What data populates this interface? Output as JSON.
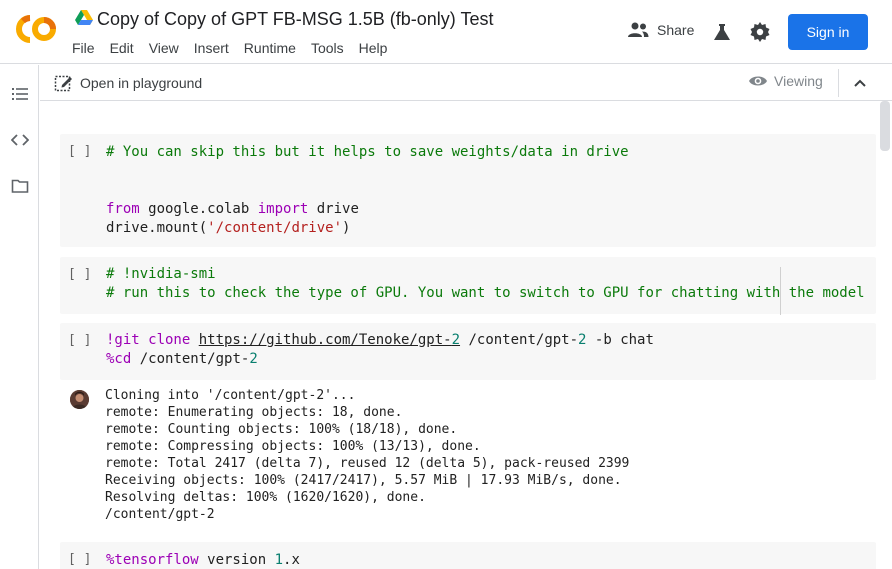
{
  "app": {
    "title": "Copy of Copy of GPT FB-MSG 1.5B (fb-only) Test",
    "logo_text": "CO",
    "menu": [
      "File",
      "Edit",
      "View",
      "Insert",
      "Runtime",
      "Tools",
      "Help"
    ],
    "share_label": "Share",
    "signin_label": "Sign in",
    "accent": "#1a73e8"
  },
  "toolbar": {
    "playground_label": "Open in playground",
    "viewing_label": "Viewing"
  },
  "cells": [
    {
      "run": "[ ]",
      "lines": [
        "# You can skip this but it helps to save weights/data in drive",
        "",
        "",
        "from google.colab import drive",
        "drive.mount('/content/drive')"
      ]
    },
    {
      "run": "[ ]",
      "lines": [
        "# !nvidia-smi",
        "# run this to check the type of GPU. You want to switch to GPU for chatting with the model"
      ]
    },
    {
      "run": "[ ]",
      "lines": [
        "!git clone https://github.com/Tenoke/gpt-2 /content/gpt-2 -b chat",
        "%cd /content/gpt-2"
      ],
      "output": [
        "Cloning into '/content/gpt-2'...",
        "remote: Enumerating objects: 18, done.",
        "remote: Counting objects: 100% (18/18), done.",
        "remote: Compressing objects: 100% (13/13), done.",
        "remote: Total 2417 (delta 7), reused 12 (delta 5), pack-reused 2399",
        "Receiving objects: 100% (2417/2417), 5.57 MiB | 17.93 MiB/s, done.",
        "Resolving deltas: 100% (1620/1620), done.",
        "/content/gpt-2"
      ]
    },
    {
      "run": "[ ]",
      "lines": [
        "%tensorflow version 1.x"
      ]
    }
  ],
  "tokens": {
    "c1_from": "from",
    "c1_mod": " google.colab ",
    "c1_import": "import",
    "c1_drive": " drive",
    "c1_mount": "drive.mount(",
    "c1_path": "'/content/drive'",
    "c1_close": ")",
    "c3_git": "!git clone ",
    "c3_url_a": "https://github.com/Tenoke/gpt-",
    "c3_url_num": "2",
    "c3_dest_a": " /content/gpt-",
    "c3_dest_num": "2",
    "c3_branch": " -b chat",
    "c3_cd": "%cd",
    "c3_cd_path": " /content/gpt-",
    "c3_cd_num": "2",
    "c4_magic": "%tensorflow",
    "c4_version": " version ",
    "c4_num": "1",
    "c4_x": ".x"
  }
}
